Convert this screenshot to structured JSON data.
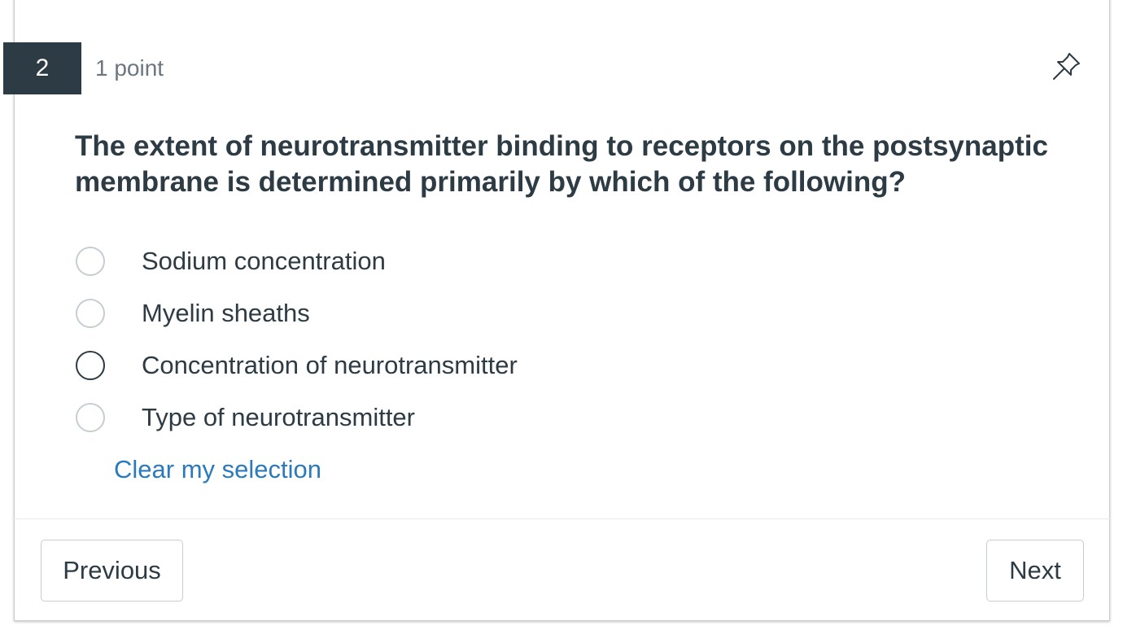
{
  "question": {
    "number": "2",
    "points": "1 point",
    "text": "The extent of neurotransmitter binding to receptors on the postsynaptic membrane is determined primarily by which of the following?",
    "options": [
      {
        "label": "Sodium concentration",
        "focused": false
      },
      {
        "label": "Myelin sheaths",
        "focused": false
      },
      {
        "label": "Concentration of neurotransmitter",
        "focused": true
      },
      {
        "label": "Type of neurotransmitter",
        "focused": false
      }
    ],
    "clear_label": "Clear my selection",
    "pin_icon": "pushpin-icon"
  },
  "nav": {
    "previous_label": "Previous",
    "next_label": "Next"
  },
  "colors": {
    "accent_link": "#2b7abc",
    "question_badge_bg": "#2d3b45",
    "text_primary": "#2d3b45",
    "text_muted": "#6b7780"
  }
}
